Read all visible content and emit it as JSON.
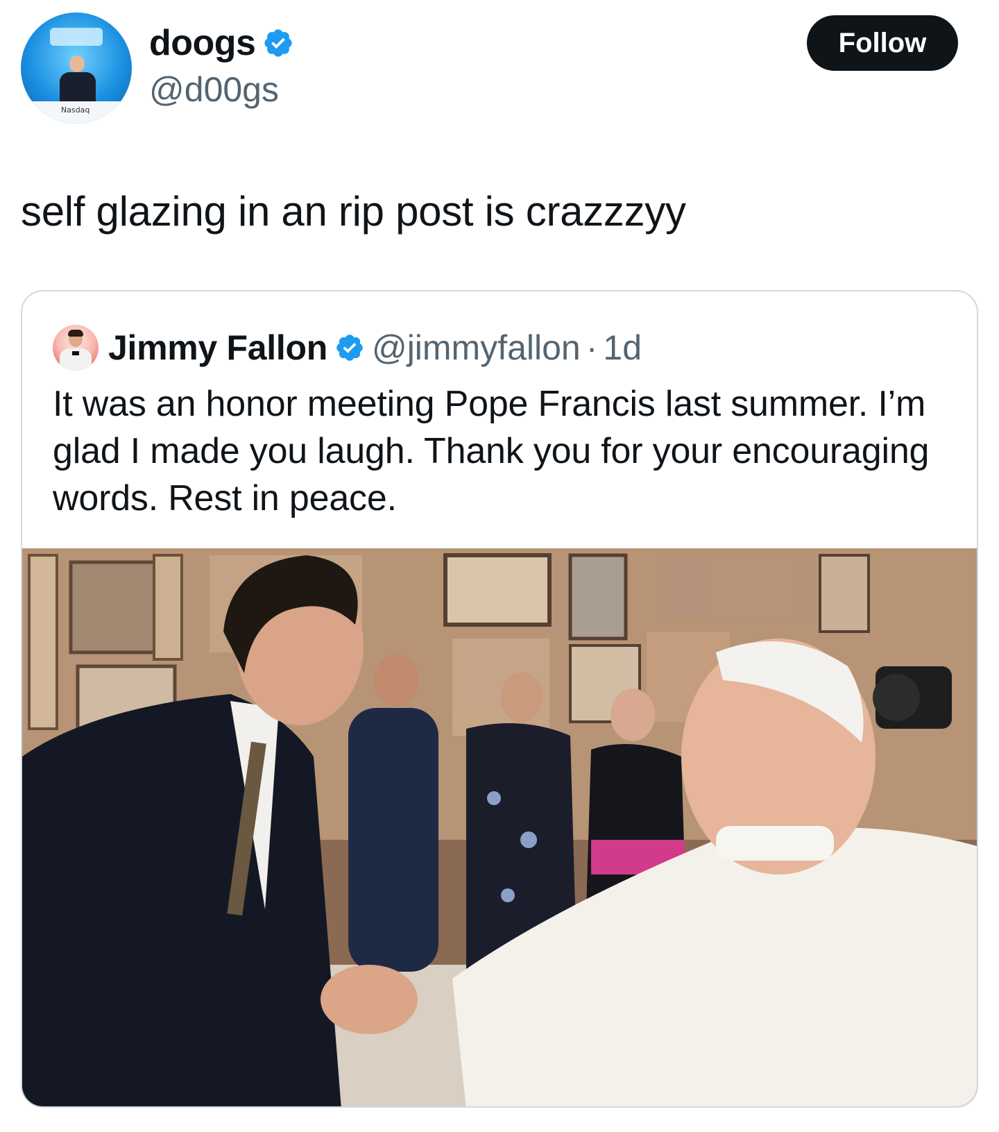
{
  "author": {
    "display_name": "doogs",
    "handle": "@d00gs",
    "verified": true,
    "avatar_caption": "Nasdaq"
  },
  "follow_label": "Follow",
  "tweet_text": "self glazing in an rip post is crazzzyy",
  "quoted": {
    "display_name": "Jimmy Fallon",
    "handle": "@jimmyfallon",
    "separator": "·",
    "time": "1d",
    "verified": true,
    "text": "It was an honor meeting Pope Francis last summer. I’m glad I made you laugh. Thank you for your encouraging words. Rest in peace."
  },
  "colors": {
    "verified_blue": "#1d9bf0",
    "follow_bg": "#0f1419",
    "secondary_text": "#536471",
    "border": "#cfd9de"
  }
}
